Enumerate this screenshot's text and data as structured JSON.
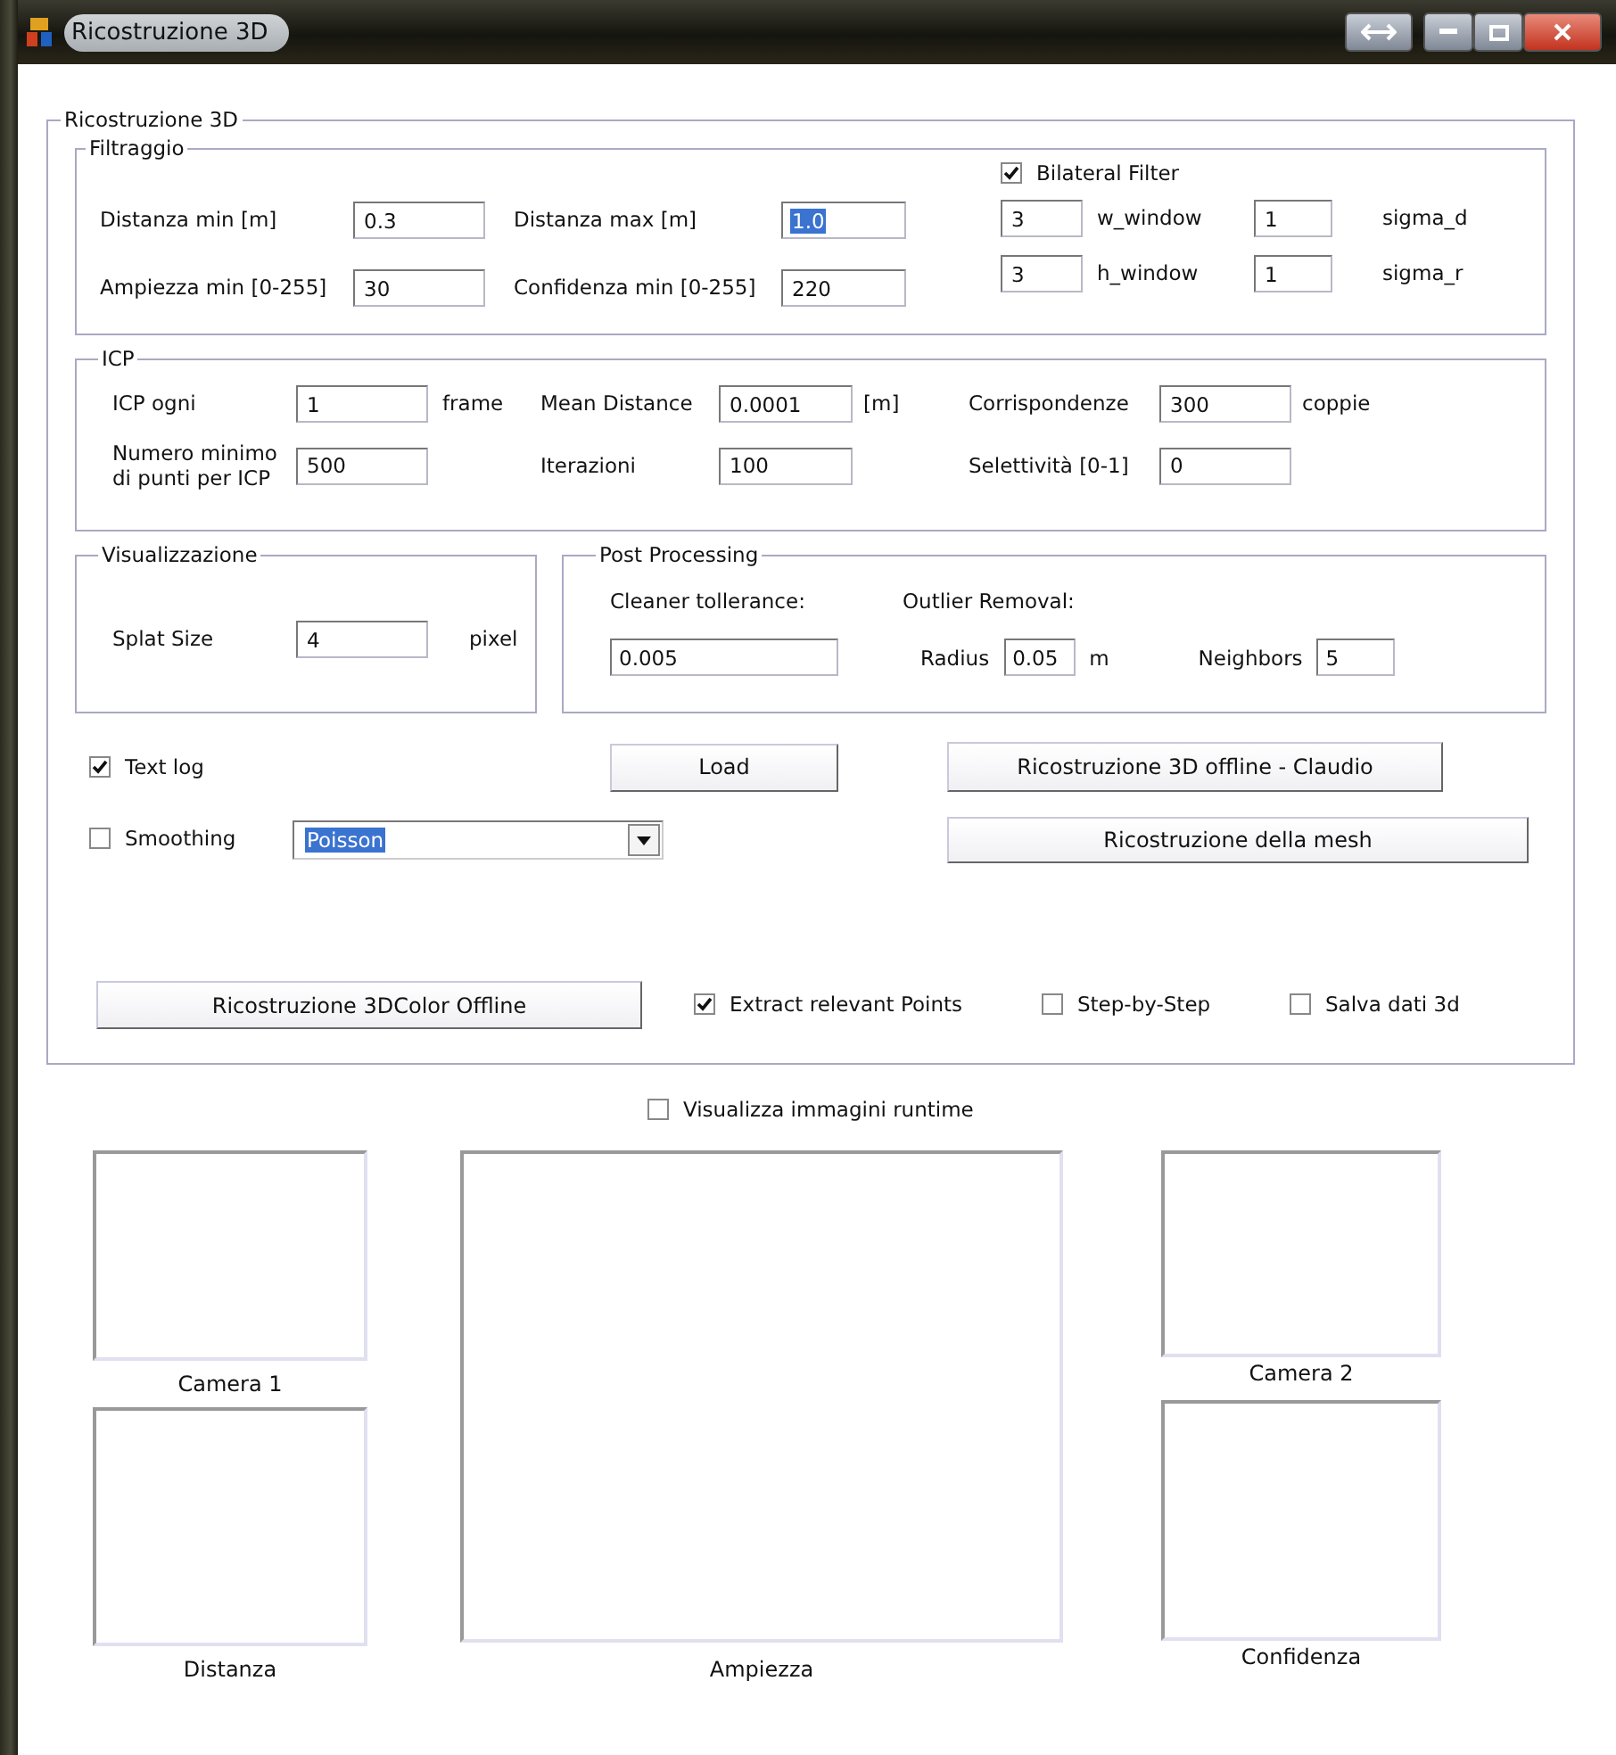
{
  "window": {
    "title": "Ricostruzione 3D"
  },
  "main": {
    "title": "Ricostruzione 3D"
  },
  "filtraggio": {
    "title": "Filtraggio",
    "rows": [
      [
        {
          "kind": "label",
          "text": "Distanza min [m]"
        },
        {
          "kind": "field",
          "value": "0.3",
          "highlighted": false
        },
        {
          "kind": "label",
          "text": "Distanza max [m]"
        },
        {
          "kind": "field",
          "value": "1.0",
          "highlighted": true
        }
      ],
      [
        {
          "kind": "label",
          "text": "Ampiezza min [0-255]"
        },
        {
          "kind": "field",
          "value": "30",
          "highlighted": false
        },
        {
          "kind": "label",
          "text": "Confidenza min [0-255]"
        },
        {
          "kind": "field",
          "value": "220",
          "highlighted": false
        }
      ]
    ],
    "bilateral": {
      "label": "Bilateral Filter",
      "checked": true
    },
    "bilateral_rows": [
      [
        {
          "kind": "field",
          "value": "3",
          "highlighted": false
        },
        {
          "kind": "label",
          "text": "w_window"
        },
        {
          "kind": "field",
          "value": "1",
          "highlighted": false
        },
        {
          "kind": "label",
          "text": "sigma_d"
        }
      ],
      [
        {
          "kind": "field",
          "value": "3",
          "highlighted": false
        },
        {
          "kind": "label",
          "text": "h_window"
        },
        {
          "kind": "field",
          "value": "1",
          "highlighted": false
        },
        {
          "kind": "label",
          "text": "sigma_r"
        }
      ]
    ]
  },
  "icp": {
    "title": "ICP",
    "rows": [
      [
        {
          "kind": "label",
          "text": "ICP ogni"
        },
        {
          "kind": "field",
          "value": "1",
          "highlighted": false
        },
        {
          "kind": "label",
          "text": "frame"
        },
        {
          "kind": "label",
          "text": "Mean Distance"
        },
        {
          "kind": "field",
          "value": "0.0001",
          "highlighted": false
        },
        {
          "kind": "label",
          "text": "[m]"
        },
        {
          "kind": "label",
          "text": "Corrispondenze"
        },
        {
          "kind": "field",
          "value": "300",
          "highlighted": false
        },
        {
          "kind": "label",
          "text": "coppie"
        }
      ],
      [
        {
          "kind": "label",
          "text": "Numero minimo\ndi punti per ICP"
        },
        {
          "kind": "field",
          "value": "500",
          "highlighted": false
        },
        {
          "kind": "spacer"
        },
        {
          "kind": "label",
          "text": "Iterazioni"
        },
        {
          "kind": "field",
          "value": "100",
          "highlighted": false
        },
        {
          "kind": "spacer"
        },
        {
          "kind": "label",
          "text": "Selettività [0-1]"
        },
        {
          "kind": "field",
          "value": "0",
          "highlighted": false
        }
      ]
    ]
  },
  "visualizzazione": {
    "title": "Visualizzazione",
    "rows": [
      [
        {
          "kind": "label",
          "text": "Splat Size"
        },
        {
          "kind": "field",
          "value": "4",
          "highlighted": false
        },
        {
          "kind": "label",
          "text": "pixel"
        }
      ]
    ]
  },
  "post_processing": {
    "title": "Post Processing",
    "cleaner_label": "Cleaner tollerance:",
    "cleaner_value": "0.005",
    "outlier_label": "Outlier Removal:",
    "radius_label": "Radius",
    "radius_value": "0.05",
    "radius_unit": "m",
    "neighbors_label": "Neighbors",
    "neighbors_value": "5"
  },
  "text_log": {
    "label": "Text log",
    "checked": true
  },
  "smoothing": {
    "label": "Smoothing",
    "checked": false
  },
  "smoothing_method": {
    "value": "Poisson",
    "highlighted": true
  },
  "buttons": {
    "load": "Load",
    "offline": "Ricostruzione 3D offline - Claudio",
    "mesh": "Ricostruzione della mesh",
    "color_offline": "Ricostruzione  3DColor Offline"
  },
  "options": [
    {
      "label": "Extract relevant Points",
      "checked": true
    },
    {
      "label": "Step-by-Step",
      "checked": false
    },
    {
      "label": "Salva dati 3d",
      "checked": false
    }
  ],
  "runtime": {
    "label": "Visualizza immagini runtime",
    "checked": false
  },
  "views": [
    {
      "label": "Camera 1"
    },
    {
      "label": "Distanza"
    },
    {
      "label": "Ampiezza"
    },
    {
      "label": "Camera 2"
    },
    {
      "label": "Confidenza"
    }
  ]
}
